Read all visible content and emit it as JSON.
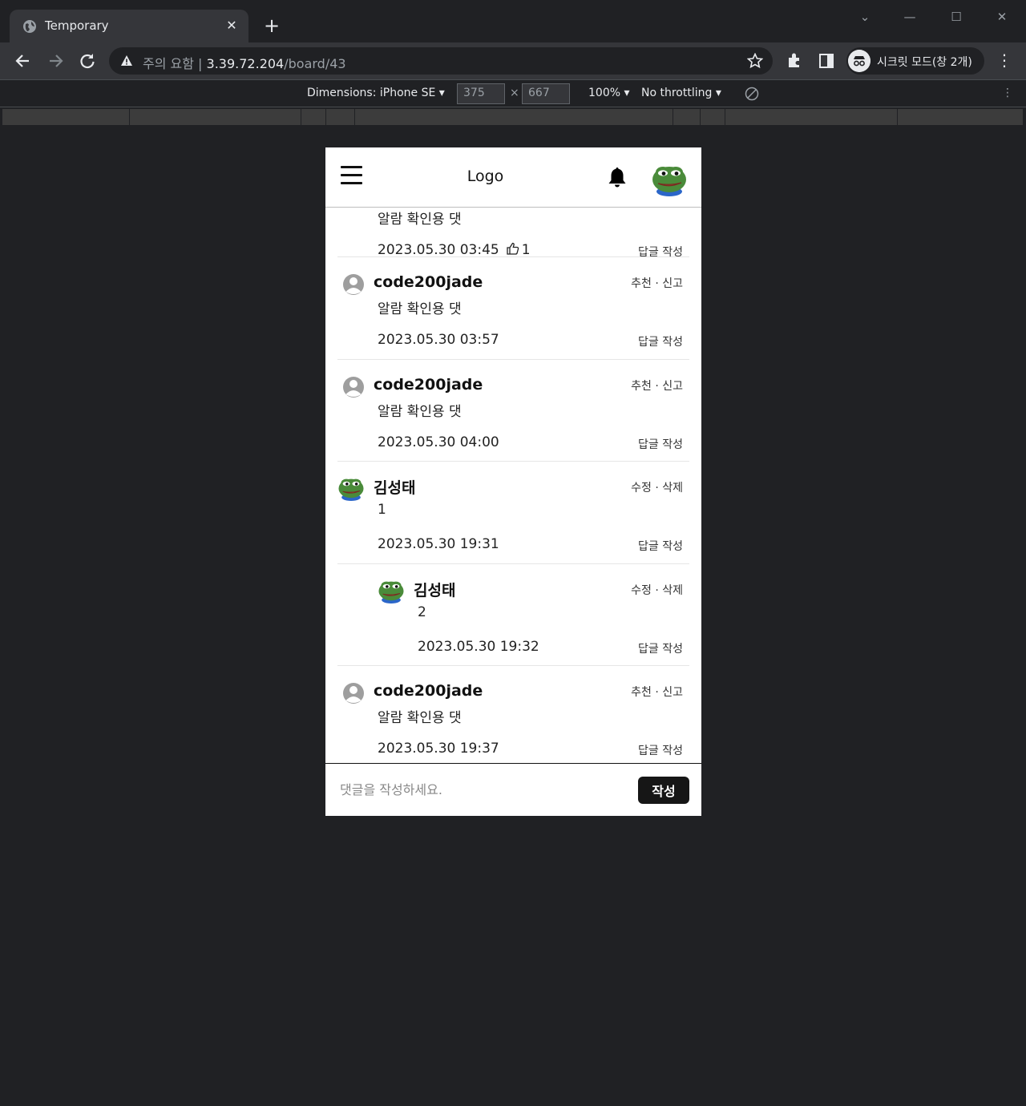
{
  "browser": {
    "tab_title": "Temporary",
    "address_warning": "주의 요함",
    "address_host": "3.39.72.204",
    "address_path": "/board/43",
    "profile_label": "시크릿 모드(창 2개)"
  },
  "device_toolbar": {
    "dimensions_label": "Dimensions: iPhone SE",
    "width": "375",
    "height": "667",
    "zoom": "100%",
    "throttling": "No throttling"
  },
  "app": {
    "logo": "Logo",
    "comments": [
      {
        "name": "",
        "actions": "",
        "body": "알람 확인용 댓",
        "date": "2023.05.30 03:45",
        "likes": "1",
        "reply": "답글 작성"
      },
      {
        "name": "code200jade",
        "actions": "추천 · 신고",
        "body": "알람 확인용 댓",
        "date": "2023.05.30 03:57",
        "reply": "답글 작성"
      },
      {
        "name": "code200jade",
        "actions": "추천 · 신고",
        "body": "알람 확인용 댓",
        "date": "2023.05.30 04:00",
        "reply": "답글 작성"
      },
      {
        "name": "김성태",
        "actions": "수정 · 삭제",
        "body": "1",
        "date": "2023.05.30 19:31",
        "reply": "답글 작성"
      },
      {
        "name": "김성태",
        "actions": "수정 · 삭제",
        "body": "2",
        "date": "2023.05.30 19:32",
        "reply": "답글 작성"
      },
      {
        "name": "code200jade",
        "actions": "추천 · 신고",
        "body": "알람 확인용 댓",
        "date": "2023.05.30 19:37",
        "reply": "답글 작성"
      }
    ],
    "input_placeholder": "댓글을 작성하세요.",
    "submit_label": "작성"
  }
}
